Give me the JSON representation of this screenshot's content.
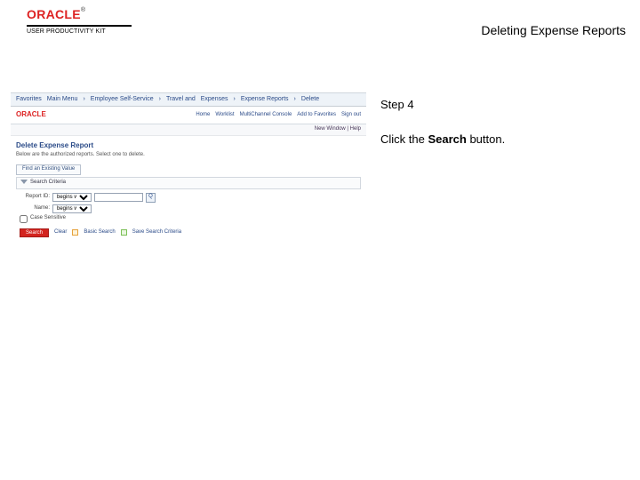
{
  "header": {
    "brand": "ORACLE",
    "tm": "®",
    "subbrand": "USER PRODUCTIVITY KIT",
    "title": "Deleting Expense Reports"
  },
  "instructions": {
    "step_label": "Step 4",
    "text_before": "Click the ",
    "text_bold": "Search",
    "text_after": " button."
  },
  "mini": {
    "nav": {
      "items": [
        "Favorites",
        "Main Menu",
        "Employee Self-Service",
        "Travel and",
        "Expenses",
        "Expense Reports",
        "Delete"
      ]
    },
    "brand": "ORACLE",
    "row2_links": [
      "Home",
      "Worklist",
      "MultiChannel Console",
      "Add to Favorites",
      "Sign out"
    ],
    "subbar": "New Window | Help",
    "page_heading": "Delete Expense Report",
    "page_desc": "Below are the authorized reports. Select one to delete.",
    "tab_label": "Find an Existing Value",
    "panel_label": "Search Criteria",
    "form": {
      "f1_label": "Report ID:",
      "f1_op": "begins with",
      "f1_val": "",
      "f2_label": "Name:",
      "f2_op": "begins with",
      "cb_label": "Case Sensitive"
    },
    "actions": {
      "search_btn": "Search",
      "clear": "Clear",
      "basic": "Basic Search",
      "save": "Save Search Criteria"
    }
  }
}
